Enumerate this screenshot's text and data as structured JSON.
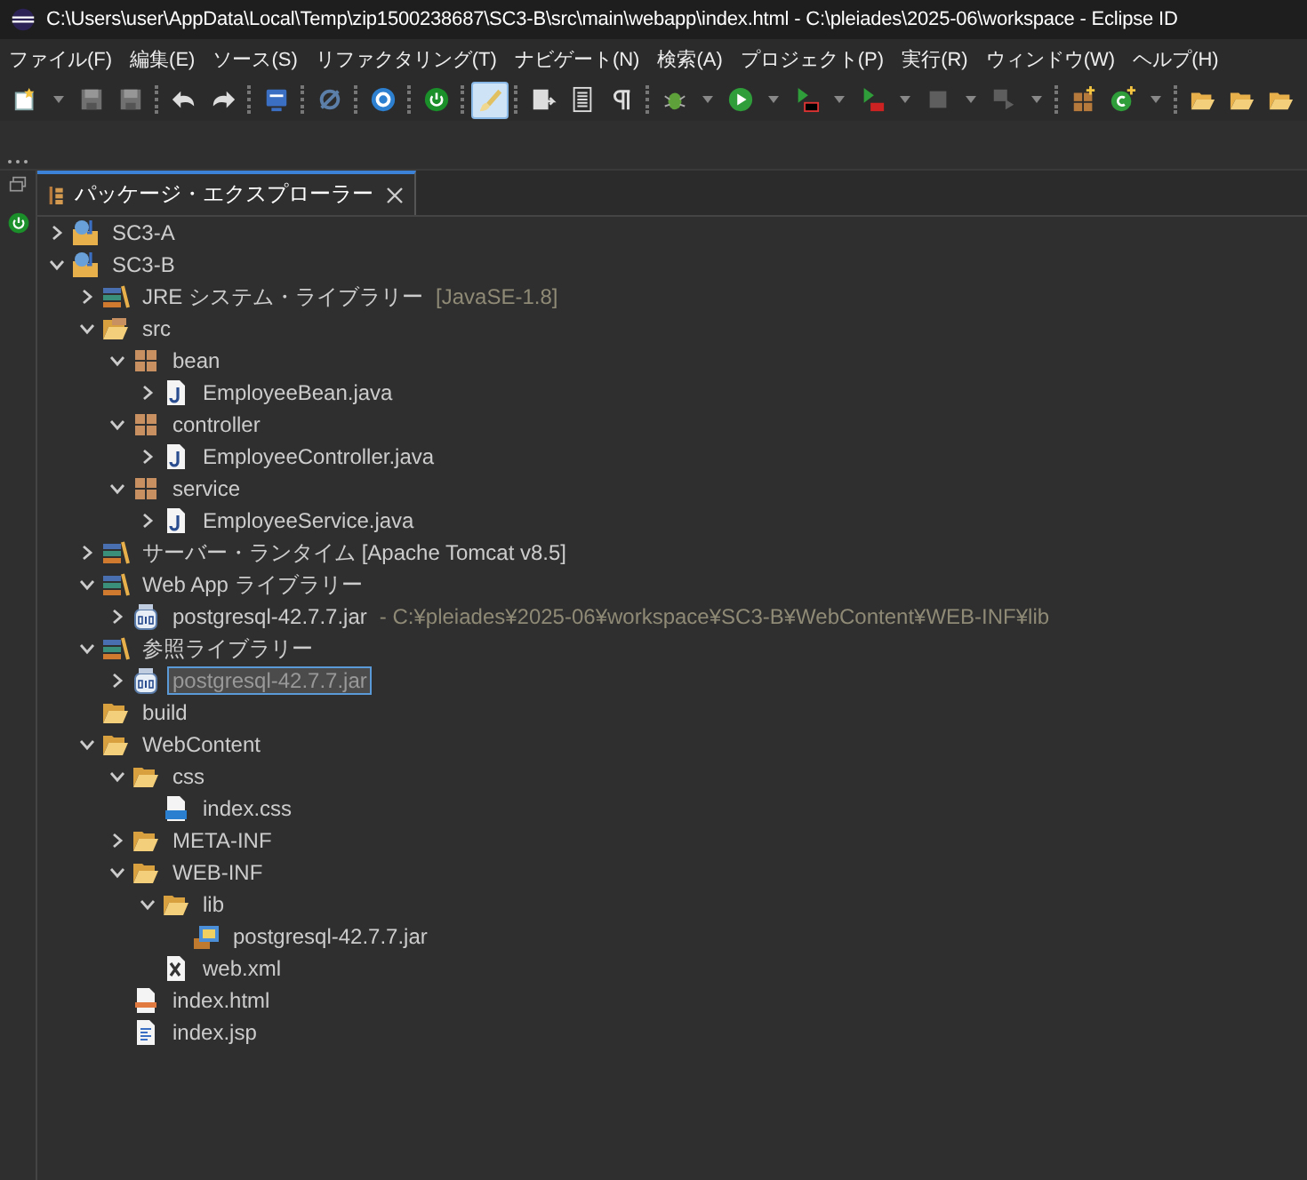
{
  "window": {
    "title": "C:\\Users\\user\\AppData\\Local\\Temp\\zip1500238687\\SC3-B\\src\\main\\webapp\\index.html - C:\\pleiades\\2025-06\\workspace - Eclipse ID"
  },
  "menu": [
    "ファイル(F)",
    "編集(E)",
    "ソース(S)",
    "リファクタリング(T)",
    "ナビゲート(N)",
    "検索(A)",
    "プロジェクト(P)",
    "実行(R)",
    "ウィンドウ(W)",
    "ヘルプ(H)"
  ],
  "toolbar": [
    {
      "kind": "new",
      "dropdown": true,
      "selected": false,
      "disabled": false
    },
    {
      "kind": "save",
      "dropdown": false,
      "selected": false,
      "disabled": true
    },
    {
      "kind": "save-all",
      "dropdown": false,
      "selected": false,
      "disabled": true
    },
    {
      "kind": "separator"
    },
    {
      "kind": "undo",
      "dropdown": false,
      "selected": false,
      "disabled": false
    },
    {
      "kind": "redo",
      "dropdown": false,
      "selected": false,
      "disabled": false
    },
    {
      "kind": "separator"
    },
    {
      "kind": "monitor",
      "dropdown": false,
      "selected": false,
      "disabled": false
    },
    {
      "kind": "separator"
    },
    {
      "kind": "skip",
      "dropdown": false,
      "selected": false,
      "disabled": false
    },
    {
      "kind": "separator"
    },
    {
      "kind": "gear",
      "dropdown": false,
      "selected": false,
      "disabled": false
    },
    {
      "kind": "separator"
    },
    {
      "kind": "power",
      "dropdown": false,
      "selected": false,
      "disabled": false
    },
    {
      "kind": "separator"
    },
    {
      "kind": "brush",
      "dropdown": false,
      "selected": true,
      "disabled": false
    },
    {
      "kind": "separator"
    },
    {
      "kind": "document",
      "dropdown": false,
      "selected": false,
      "disabled": false
    },
    {
      "kind": "list",
      "dropdown": false,
      "selected": false,
      "disabled": false
    },
    {
      "kind": "pilcrow",
      "dropdown": false,
      "selected": false,
      "disabled": false
    },
    {
      "kind": "separator"
    },
    {
      "kind": "bug",
      "dropdown": true,
      "selected": false,
      "disabled": false
    },
    {
      "kind": "run",
      "dropdown": true,
      "selected": false,
      "disabled": false
    },
    {
      "kind": "run-external",
      "dropdown": true,
      "selected": false,
      "disabled": false
    },
    {
      "kind": "run-server",
      "dropdown": true,
      "selected": false,
      "disabled": false
    },
    {
      "kind": "stop",
      "dropdown": true,
      "selected": false,
      "disabled": true
    },
    {
      "kind": "step",
      "dropdown": true,
      "selected": false,
      "disabled": true
    },
    {
      "kind": "separator"
    },
    {
      "kind": "package-new",
      "dropdown": false,
      "selected": false,
      "disabled": false
    },
    {
      "kind": "class-new",
      "dropdown": true,
      "selected": false,
      "disabled": false
    },
    {
      "kind": "separator"
    },
    {
      "kind": "folder-open",
      "dropdown": false,
      "selected": false,
      "disabled": false
    },
    {
      "kind": "folder-open",
      "dropdown": false,
      "selected": false,
      "disabled": false
    },
    {
      "kind": "folder-open",
      "dropdown": false,
      "selected": false,
      "disabled": false
    }
  ],
  "view_tab": {
    "label": "パッケージ・エクスプローラー",
    "selected": true
  },
  "tree": [
    {
      "kind": "project",
      "label": "SC3-A",
      "expanded": false,
      "selected": false
    },
    {
      "kind": "project",
      "label": "SC3-B",
      "expanded": true,
      "selected": false,
      "children": [
        {
          "kind": "library",
          "label": "JRE システム・ライブラリー",
          "decoration": "[JavaSE-1.8]",
          "expanded": false,
          "selected": false
        },
        {
          "kind": "source-folder",
          "label": "src",
          "expanded": true,
          "selected": false,
          "children": [
            {
              "kind": "package",
              "label": "bean",
              "expanded": true,
              "selected": false,
              "children": [
                {
                  "kind": "java",
                  "label": "EmployeeBean.java",
                  "expanded": false,
                  "selected": false
                }
              ]
            },
            {
              "kind": "package",
              "label": "controller",
              "expanded": true,
              "selected": false,
              "children": [
                {
                  "kind": "java",
                  "label": "EmployeeController.java",
                  "expanded": false,
                  "selected": false
                }
              ]
            },
            {
              "kind": "package",
              "label": "service",
              "expanded": true,
              "selected": false,
              "children": [
                {
                  "kind": "java",
                  "label": "EmployeeService.java",
                  "expanded": false,
                  "selected": false
                }
              ]
            }
          ]
        },
        {
          "kind": "library",
          "label": "サーバー・ランタイム [Apache Tomcat v8.5]",
          "expanded": false,
          "selected": false
        },
        {
          "kind": "library",
          "label": "Web App ライブラリー",
          "expanded": true,
          "selected": false,
          "children": [
            {
              "kind": "jar",
              "label": "postgresql-42.7.7.jar",
              "decoration": "- C:¥pleiades¥2025-06¥workspace¥SC3-B¥WebContent¥WEB-INF¥lib",
              "expanded": false,
              "selected": false
            }
          ]
        },
        {
          "kind": "library",
          "label": "参照ライブラリー",
          "expanded": true,
          "selected": false,
          "children": [
            {
              "kind": "jar",
              "label": "postgresql-42.7.7.jar",
              "expanded": false,
              "selected": true
            }
          ]
        },
        {
          "kind": "folder",
          "label": "build",
          "selected": false
        },
        {
          "kind": "folder",
          "label": "WebContent",
          "expanded": true,
          "selected": false,
          "children": [
            {
              "kind": "folder",
              "label": "css",
              "expanded": true,
              "selected": false,
              "children": [
                {
                  "kind": "css",
                  "label": "index.css",
                  "selected": false
                }
              ]
            },
            {
              "kind": "folder",
              "label": "META-INF",
              "expanded": false,
              "selected": false
            },
            {
              "kind": "folder",
              "label": "WEB-INF",
              "expanded": true,
              "selected": false,
              "children": [
                {
                  "kind": "folder",
                  "label": "lib",
                  "expanded": true,
                  "selected": false,
                  "children": [
                    {
                      "kind": "jar-file",
                      "label": "postgresql-42.7.7.jar",
                      "selected": false
                    }
                  ]
                },
                {
                  "kind": "xml",
                  "label": "web.xml",
                  "selected": false
                }
              ]
            },
            {
              "kind": "html",
              "label": "index.html",
              "selected": false
            },
            {
              "kind": "jsp",
              "label": "index.jsp",
              "selected": false
            }
          ]
        }
      ]
    }
  ]
}
